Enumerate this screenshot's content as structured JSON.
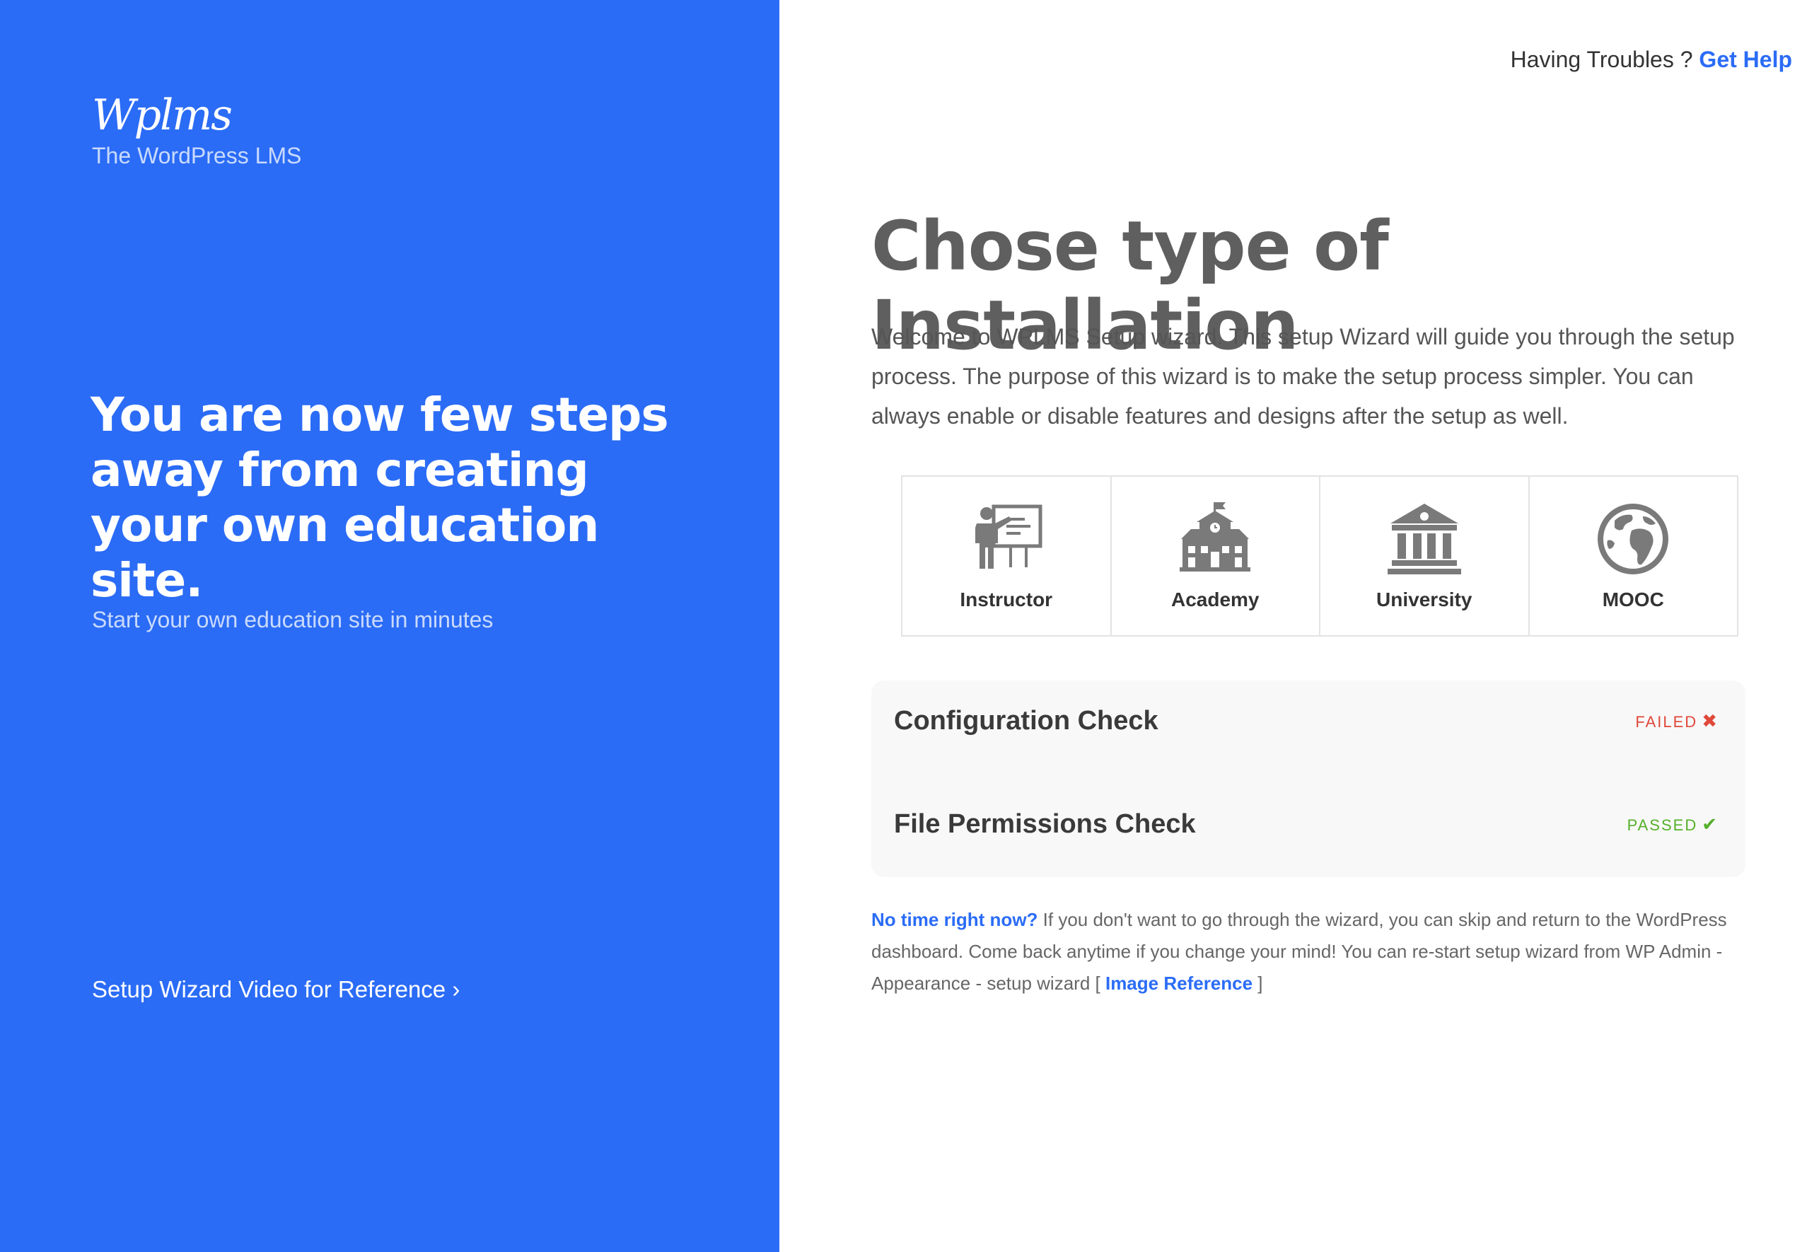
{
  "sidebar": {
    "logo_text": "Wplms",
    "logo_subtitle": "The WordPress LMS",
    "hero_heading": "You are now few steps away from creating your own education site.",
    "hero_subtext": "Start your own education site in minutes",
    "video_link": "Setup Wizard Video for Reference ›"
  },
  "header": {
    "trouble_text": "Having Troubles ?",
    "help_link": "Get Help"
  },
  "main": {
    "title": "Chose type of Installation",
    "intro": "Welcome to WPLMS Setup wizard. This setup Wizard will guide you through the setup process. The purpose of this wizard is to make the setup process simpler. You can always enable or disable features and designs after the setup as well.",
    "install_types": [
      {
        "label": "Instructor",
        "icon": "instructor-icon"
      },
      {
        "label": "Academy",
        "icon": "academy-icon"
      },
      {
        "label": "University",
        "icon": "university-icon"
      },
      {
        "label": "MOOC",
        "icon": "globe-icon"
      }
    ],
    "checks": [
      {
        "name": "Configuration Check",
        "status": "FAILED",
        "mark": "✖",
        "color": "#e0493a"
      },
      {
        "name": "File Permissions Check",
        "status": "PASSED",
        "mark": "✔",
        "color": "#55b02a"
      }
    ],
    "note": {
      "skip_link": "No time right now?",
      "text": " If you don't want to go through the wizard, you can skip and return to the WordPress dashboard. Come back anytime if you change your mind! You can re-start setup wizard from WP Admin - Appearance - setup wizard [ ",
      "image_link": "Image Reference",
      "tail": " ]"
    }
  },
  "colors": {
    "brand_blue": "#2b6cf6",
    "icon_gray": "#7a7a7a"
  }
}
